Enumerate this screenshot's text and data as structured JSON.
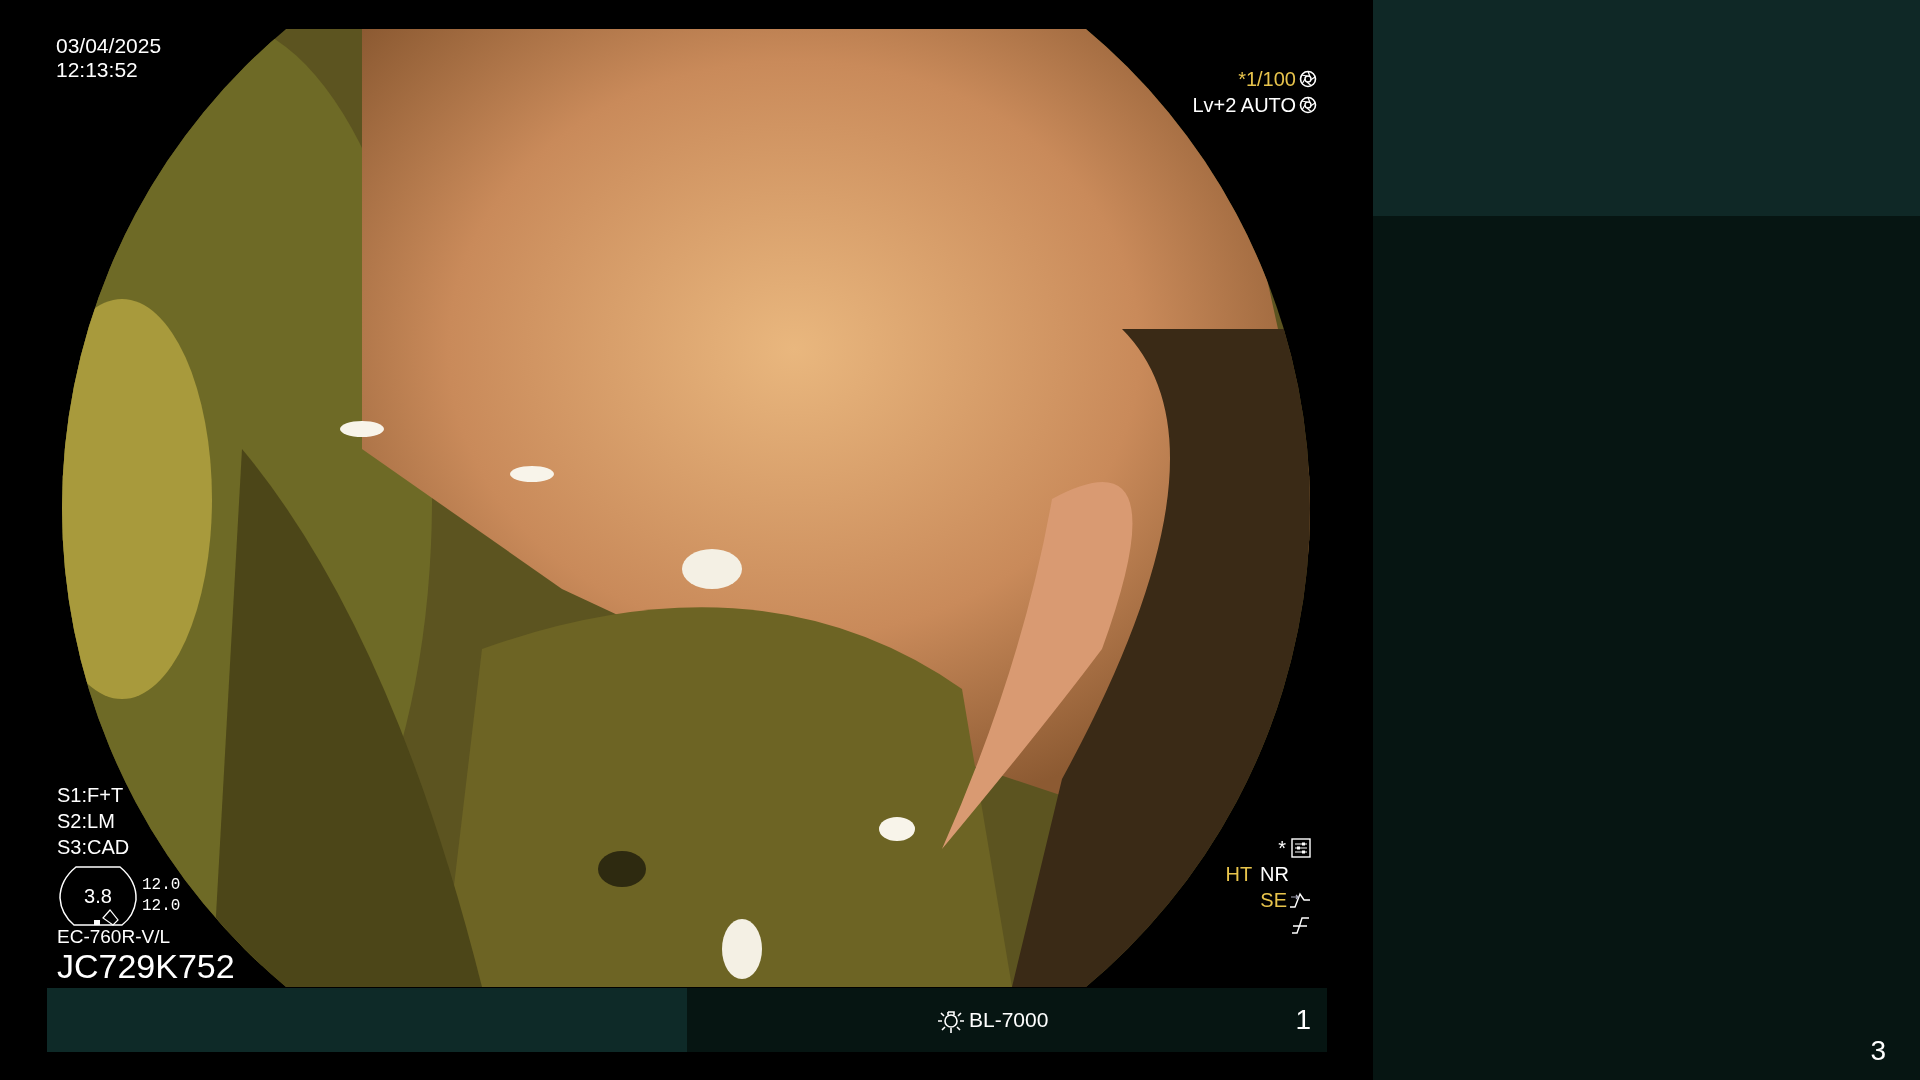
{
  "datetime": {
    "date": "03/04/2025",
    "time": "12:13:52"
  },
  "exposure": {
    "shutter": "*1/100",
    "mode": "Lv+2 AUTO"
  },
  "scope_functions": [
    "S1:F+T",
    "S2:LM",
    "S3:CAD"
  ],
  "gauge": {
    "value": "3.8",
    "readings": [
      "12.0",
      "12.0"
    ]
  },
  "scope": {
    "model": "EC-760R-V/L",
    "serial": "JC729K752"
  },
  "settings_marker": "*",
  "enhancements": [
    {
      "label": "HT",
      "highlighted": true
    },
    {
      "label": "NR",
      "highlighted": false
    }
  ],
  "edge_enhancement": {
    "label": "SE",
    "highlighted": true
  },
  "light_source": "BL-7000",
  "channel": "1",
  "page_number": "3"
}
